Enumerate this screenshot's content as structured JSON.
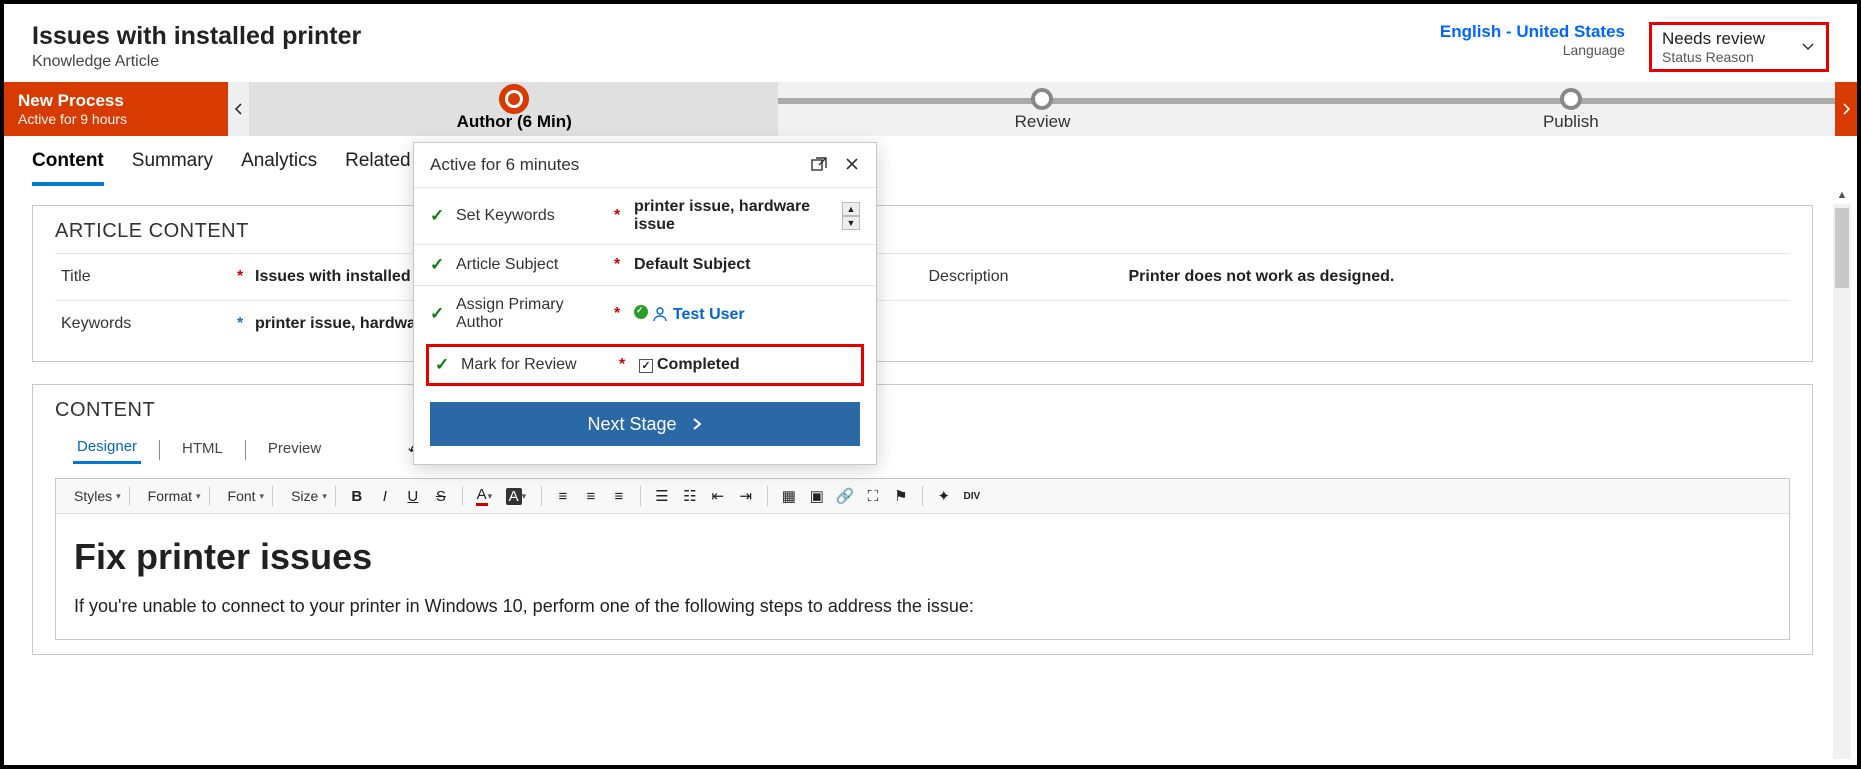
{
  "header": {
    "title": "Issues with installed printer",
    "subtitle": "Knowledge Article",
    "language_value": "English - United States",
    "language_label": "Language",
    "status_value": "Needs review",
    "status_label": "Status Reason"
  },
  "process": {
    "name": "New Process",
    "active_for": "Active for 9 hours",
    "stages": [
      {
        "label": "Author  (6 Min)",
        "active": true
      },
      {
        "label": "Review",
        "active": false
      },
      {
        "label": "Publish",
        "active": false
      }
    ]
  },
  "tabs": [
    "Content",
    "Summary",
    "Analytics",
    "Related"
  ],
  "active_tab": "Content",
  "article": {
    "section_title": "ARTICLE CONTENT",
    "title_label": "Title",
    "title_value": "Issues with installed printer",
    "description_label": "Description",
    "description_value": "Printer does not work as designed.",
    "keywords_label": "Keywords",
    "keywords_value": "printer issue, hardware issue"
  },
  "content_editor": {
    "section_title": "CONTENT",
    "tabs": [
      "Designer",
      "HTML",
      "Preview"
    ],
    "active_tab": "Designer",
    "toolbar": {
      "styles": "Styles",
      "format": "Format",
      "font": "Font",
      "size": "Size"
    },
    "heading": "Fix printer issues",
    "paragraph": "If you're unable to connect to your printer in Windows 10, perform one of the following steps to address the issue:"
  },
  "flyout": {
    "heading": "Active for 6 minutes",
    "rows": [
      {
        "label": "Set Keywords",
        "value": "printer issue, hardware issue",
        "spinner": true
      },
      {
        "label": "Article Subject",
        "value": "Default Subject"
      },
      {
        "label": "Assign Primary Author",
        "value": "Test User",
        "user": true
      },
      {
        "label": "Mark for Review",
        "value": "Completed",
        "checkbox": true,
        "highlight": true
      }
    ],
    "next_button": "Next Stage"
  }
}
